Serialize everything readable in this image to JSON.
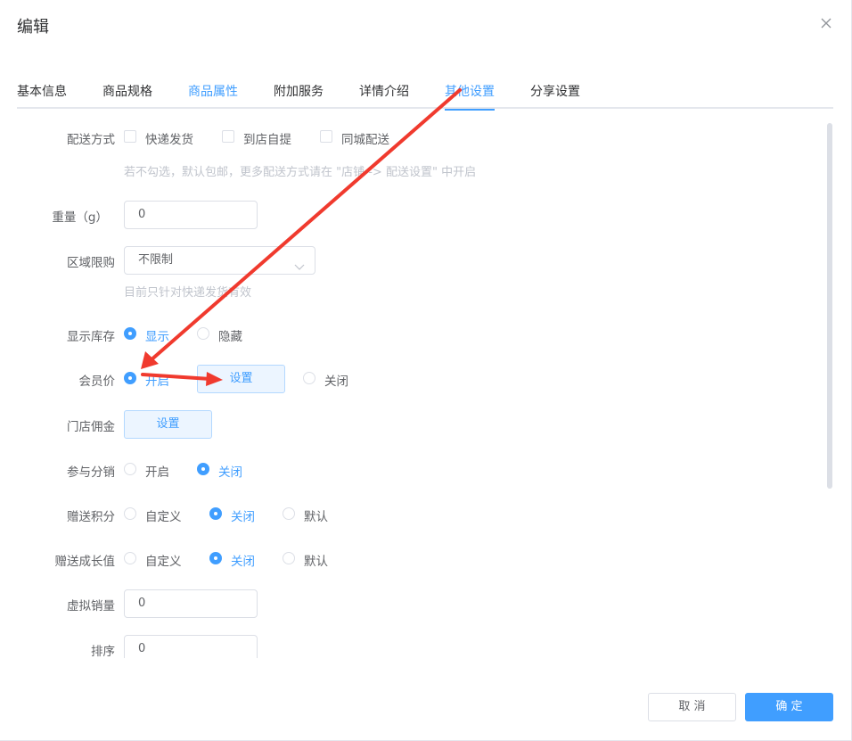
{
  "dialog": {
    "title": "编辑"
  },
  "tabs": [
    {
      "label": "基本信息"
    },
    {
      "label": "商品规格"
    },
    {
      "label": "商品属性"
    },
    {
      "label": "附加服务"
    },
    {
      "label": "详情介绍"
    },
    {
      "label": "其他设置"
    },
    {
      "label": "分享设置"
    }
  ],
  "form": {
    "delivery": {
      "label": "配送方式",
      "options": [
        "快递发货",
        "到店自提",
        "同城配送"
      ],
      "hint": "若不勾选，默认包邮，更多配送方式请在 \"店铺 -> 配送设置\" 中开启"
    },
    "weight": {
      "label": "重量（g）",
      "value": "0"
    },
    "region": {
      "label": "区域限购",
      "value": "不限制",
      "hint": "目前只针对快递发货有效"
    },
    "stock": {
      "label": "显示库存",
      "options": [
        "显示",
        "隐藏"
      ],
      "selected": "显示"
    },
    "member_price": {
      "label": "会员价",
      "on_label": "开启",
      "set_label": "设置",
      "off_label": "关闭",
      "selected": "开启"
    },
    "store_commission": {
      "label": "门店佣金",
      "set_label": "设置"
    },
    "distribution": {
      "label": "参与分销",
      "options": [
        "开启",
        "关闭"
      ],
      "selected": "关闭"
    },
    "points": {
      "label": "赠送积分",
      "options": [
        "自定义",
        "关闭",
        "默认"
      ],
      "selected": "关闭"
    },
    "growth": {
      "label": "赠送成长值",
      "options": [
        "自定义",
        "关闭",
        "默认"
      ],
      "selected": "关闭"
    },
    "virtual_sales": {
      "label": "虚拟销量",
      "value": "0"
    },
    "sort": {
      "label": "排序",
      "value": "0"
    }
  },
  "footer": {
    "cancel_label": "取 消",
    "ok_label": "确 定"
  },
  "colors": {
    "accent": "#409eff",
    "annotation_arrow": "#f03a2e"
  }
}
